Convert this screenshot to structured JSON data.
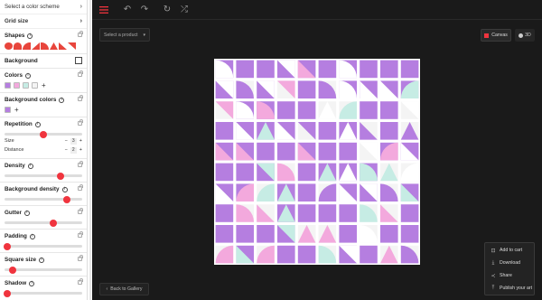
{
  "sidebar": {
    "color_scheme": "Select a color scheme",
    "grid_size": "Grid size",
    "shapes_title": "Shapes",
    "background_title": "Background",
    "colors_title": "Colors",
    "colors": [
      "#b57ee0",
      "#f3a9dd",
      "#c6ece4",
      "#f4f4f4"
    ],
    "background_colors_title": "Background colors",
    "background_colors": [
      "#b57ee0"
    ],
    "repetition_title": "Repetition",
    "repetition_value": 0.5,
    "size_label": "Size",
    "size_value": "3",
    "distance_label": "Distance",
    "distance_value": "2",
    "density_title": "Density",
    "density_value": 0.72,
    "background_density_title": "Background density",
    "background_density_value": 0.8,
    "gutter_title": "Gutter",
    "gutter_value": 0.63,
    "padding_title": "Padding",
    "padding_value": 0.04,
    "square_size_title": "Square size",
    "square_size_value": 0.1,
    "shadow_title": "Shadow",
    "shadow_value": 0.04,
    "accent": "#f0343e"
  },
  "toolbar": {
    "menu_icon": "hamburger-icon",
    "undo_icon": "undo-icon",
    "redo_icon": "redo-icon",
    "refresh_icon": "refresh-icon",
    "shuffle_icon": "shuffle-icon"
  },
  "main": {
    "select_product": "Select a product",
    "canvas_label": "Canvas",
    "threed_label": "3D",
    "back_label": "Back to Gallery"
  },
  "actions": [
    {
      "label": "Add to cart",
      "icon": "cart-icon"
    },
    {
      "label": "Download",
      "icon": "download-icon"
    },
    {
      "label": "Share",
      "icon": "share-icon"
    },
    {
      "label": "Publish your art",
      "icon": "upload-icon"
    }
  ]
}
